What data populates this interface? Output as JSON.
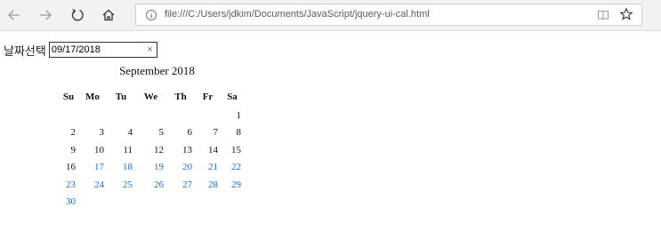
{
  "browser": {
    "url": "file:///C:/Users/jdkim/Documents/JavaScript/jquery-ui-cal.html",
    "icons": [
      "back-icon",
      "forward-icon",
      "refresh-icon",
      "home-icon",
      "info-icon",
      "reading-view-icon",
      "favorite-star-icon"
    ]
  },
  "form": {
    "label": "날짜선택",
    "date_value": "09/17/2018",
    "clear_symbol": "×"
  },
  "calendar": {
    "title": "September 2018",
    "weekdays": [
      "Su",
      "Mo",
      "Tu",
      "We",
      "Th",
      "Fr",
      "Sa"
    ],
    "weeks": [
      [
        "",
        "",
        "",
        "",
        "",
        "",
        "1"
      ],
      [
        "2",
        "3",
        "4",
        "5",
        "6",
        "7",
        "8"
      ],
      [
        "9",
        "10",
        "11",
        "12",
        "13",
        "14",
        "15"
      ],
      [
        "16",
        "17",
        "18",
        "19",
        "20",
        "21",
        "22"
      ],
      [
        "23",
        "24",
        "25",
        "26",
        "27",
        "28",
        "29"
      ],
      [
        "30",
        "",
        "",
        "",
        "",
        "",
        ""
      ]
    ],
    "selected_day": "17",
    "colors": {
      "past_day": "#111111",
      "future_day": "#1a6bc9"
    }
  }
}
